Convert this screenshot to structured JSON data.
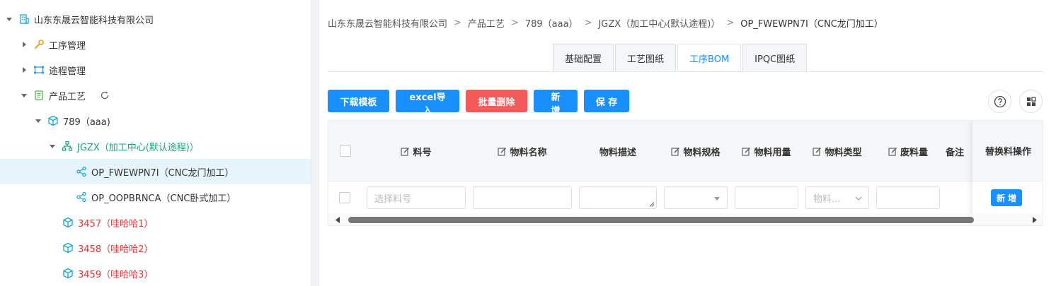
{
  "sidebar": {
    "root": {
      "label": "山东东晟云智能科技有限公司"
    },
    "items": [
      {
        "label": "工序管理"
      },
      {
        "label": "途程管理"
      },
      {
        "label": "产品工艺"
      }
    ],
    "product": {
      "label": "789（aaa)"
    },
    "route": {
      "label": "JGZX（加工中心(默认途程)）"
    },
    "ops": [
      {
        "label": "OP_FWEWPN7I（CNC龙门加工）"
      },
      {
        "label": "OP_OOPBRNCA（CNC卧式加工）"
      }
    ],
    "others": [
      {
        "label": "3457（哇哈哈1）"
      },
      {
        "label": "3458（哇哈哈2）"
      },
      {
        "label": "3459（哇哈哈3）"
      }
    ]
  },
  "breadcrumb": [
    "山东东晟云智能科技有限公司",
    "产品工艺",
    "789（aaa）",
    "JGZX（加工中心(默认途程)）",
    "OP_FWEWPN7I（CNC龙门加工）"
  ],
  "breadcrumb_sep": ">",
  "tabs": [
    "基础配置",
    "工艺图纸",
    "工序BOM",
    "IPQC图纸"
  ],
  "active_tab": "工序BOM",
  "toolbar": {
    "download": "下载模板",
    "import": "excel导入",
    "batch_delete": "批量删除",
    "add": "新 增",
    "save": "保 存"
  },
  "table": {
    "headers": [
      "料号",
      "物料名称",
      "物料描述",
      "物料规格",
      "物料用量",
      "物料类型",
      "废料量",
      "备注",
      "替换料操作"
    ],
    "row": {
      "part_placeholder": "选择料号",
      "type_placeholder": "物料...",
      "add_label": "新 增"
    }
  },
  "colors": {
    "accent": "#1890ff",
    "danger": "#f45a5a",
    "tree_green": "#17a67a",
    "tree_red": "#f23030",
    "selected_bg": "#e6f4fc"
  }
}
